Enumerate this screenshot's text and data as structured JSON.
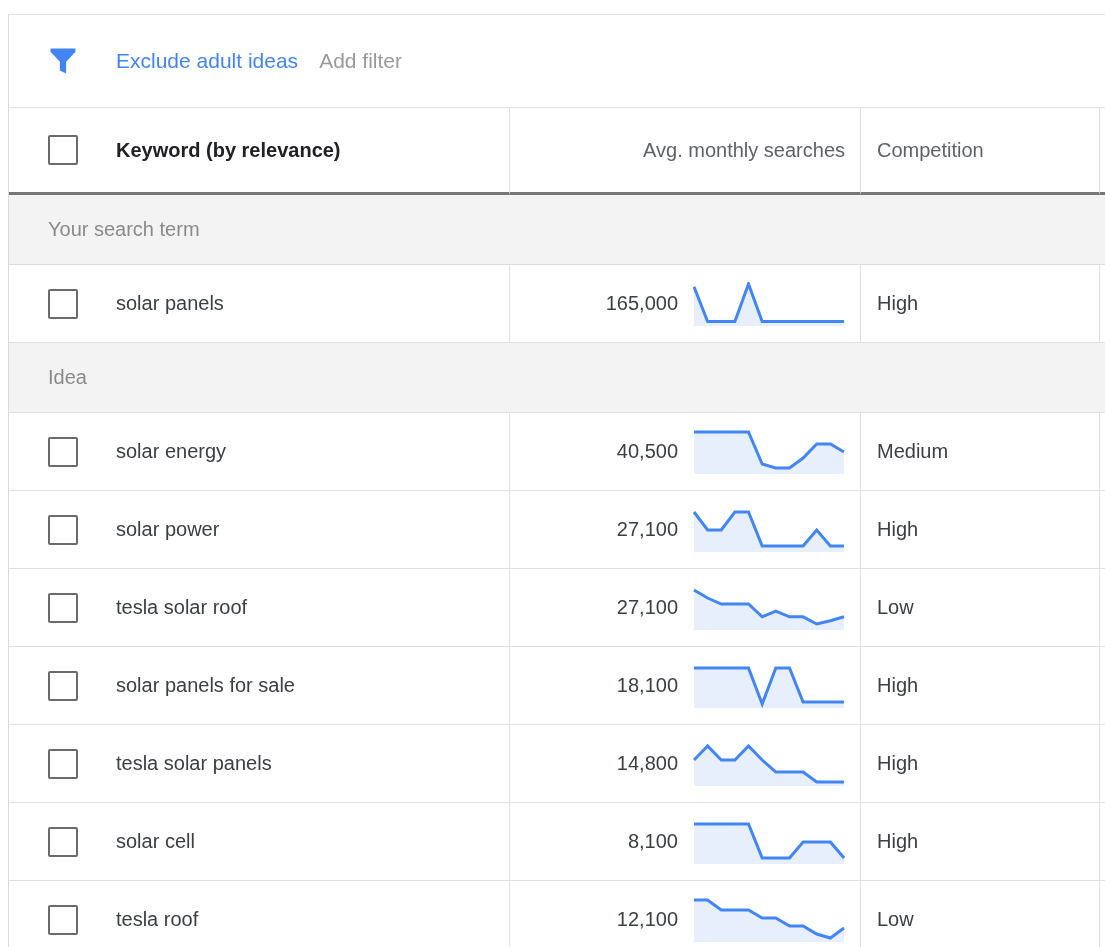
{
  "filter_bar": {
    "links": [
      {
        "text": "Exclude adult ideas",
        "kind": "active"
      },
      {
        "text": "Add filter",
        "kind": "muted"
      }
    ]
  },
  "table": {
    "header": {
      "checked": false,
      "columns": [
        "Keyword (by relevance)",
        "Avg. monthly searches",
        "Competition"
      ]
    },
    "sections": [
      {
        "label": "Your search term",
        "rows": [
          {
            "keyword": "solar panels",
            "searches": "165,000",
            "competition": "High",
            "checked": false
          }
        ]
      },
      {
        "label": "Idea",
        "rows": [
          {
            "keyword": "solar energy",
            "searches": "40,500",
            "competition": "Medium",
            "checked": false
          },
          {
            "keyword": "solar power",
            "searches": "27,100",
            "competition": "High",
            "checked": false
          },
          {
            "keyword": "tesla solar roof",
            "searches": "27,100",
            "competition": "Low",
            "checked": false
          },
          {
            "keyword": "solar panels for sale",
            "searches": "18,100",
            "competition": "High",
            "checked": false
          },
          {
            "keyword": "tesla solar panels",
            "searches": "14,800",
            "competition": "High",
            "checked": false
          },
          {
            "keyword": "solar cell",
            "searches": "8,100",
            "competition": "High",
            "checked": false
          },
          {
            "keyword": "tesla roof",
            "searches": "12,100",
            "competition": "Low",
            "checked": false
          }
        ]
      }
    ]
  }
}
